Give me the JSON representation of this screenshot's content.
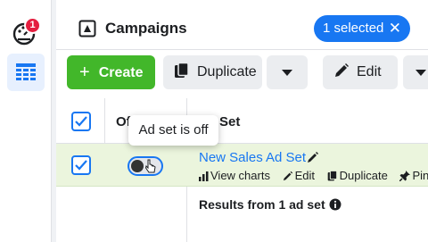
{
  "sidebar": {
    "notification_count": "1",
    "items": [
      {
        "icon": "dashboard-icon"
      },
      {
        "icon": "table-icon",
        "active": true
      }
    ]
  },
  "header": {
    "title": "Campaigns",
    "selected_label": "1 selected",
    "clear_symbol": "✕"
  },
  "toolbar": {
    "create_label": "Create",
    "create_symbol": "+",
    "duplicate_label": "Duplicate",
    "edit_label": "Edit"
  },
  "table": {
    "columns": [
      {
        "label": "Of"
      },
      {
        "label": "Set"
      }
    ],
    "rows": [
      {
        "name": "New Sales Ad Set",
        "status": "off",
        "actions": [
          "View charts",
          "Edit",
          "Duplicate",
          "Pin"
        ]
      }
    ],
    "results_label": "Results from 1 ad set"
  },
  "tooltip": {
    "text": "Ad set is off"
  },
  "colors": {
    "primary": "#1877f2",
    "create_green": "#42b72a",
    "row_selected": "#ebf5dd",
    "notification": "#e41e3f"
  }
}
